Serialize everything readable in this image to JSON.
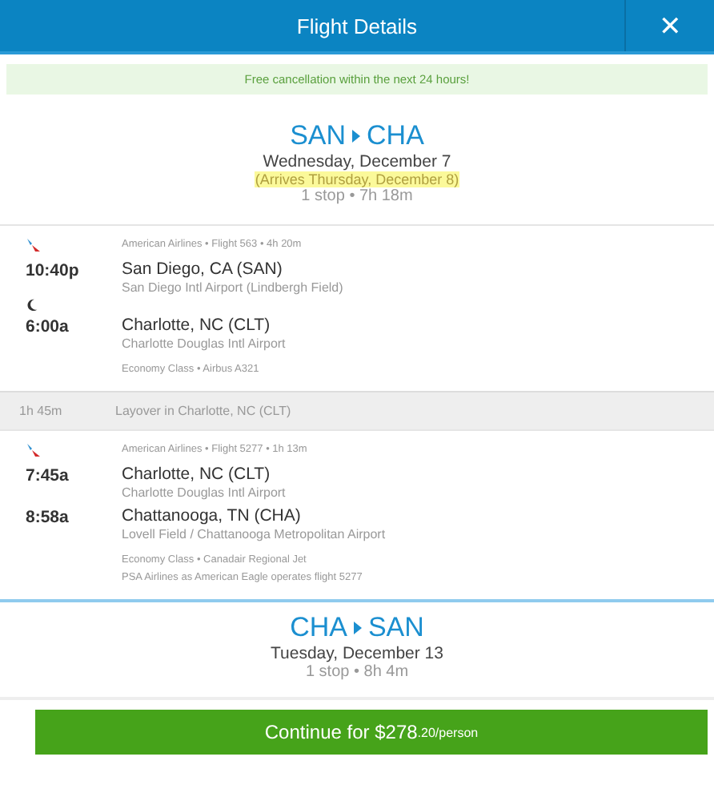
{
  "window": {
    "title": "Flight Details",
    "close": "✕"
  },
  "notice": "Free cancellation within the next 24 hours!",
  "outbound": {
    "origin": "SAN",
    "destination": "CHA",
    "date": "Wednesday, December 7",
    "arrival_note": "(Arrives Thursday, December 8)",
    "summary": "1 stop • 7h 18m"
  },
  "segments": [
    {
      "kind": "flight",
      "info": "American Airlines • Flight 563 • 4h 20m",
      "depart_time": "10:40p",
      "depart_city": "San Diego, CA (SAN)",
      "depart_airport": "San Diego Intl Airport (Lindbergh Field)",
      "overnight": true,
      "arrive_time": "6:00a",
      "arrive_city": "Charlotte, NC (CLT)",
      "arrive_airport": "Charlotte Douglas Intl Airport",
      "notes": [
        "Economy Class • Airbus A321"
      ]
    },
    {
      "kind": "layover",
      "duration": "1h 45m",
      "text": "Layover in Charlotte, NC (CLT)"
    },
    {
      "kind": "flight",
      "info": "American Airlines • Flight 5277 • 1h 13m",
      "depart_time": "7:45a",
      "depart_city": "Charlotte, NC (CLT)",
      "depart_airport": "Charlotte Douglas Intl Airport",
      "overnight": false,
      "arrive_time": "8:58a",
      "arrive_city": "Chattanooga, TN (CHA)",
      "arrive_airport": "Lovell Field / Chattanooga Metropolitan Airport",
      "notes": [
        "Economy Class • Canadair Regional Jet",
        "PSA Airlines as American Eagle operates flight 5277"
      ]
    }
  ],
  "return": {
    "origin": "CHA",
    "destination": "SAN",
    "date": "Tuesday, December 13",
    "summary": "1 stop • 8h 4m"
  },
  "continue_button": {
    "label": "Continue for $278",
    "cents": ".20/person"
  }
}
